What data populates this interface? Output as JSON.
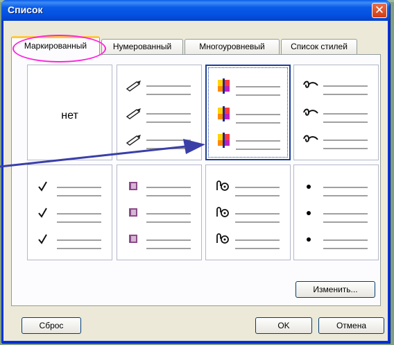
{
  "dialog": {
    "title": "Список",
    "close_glyph": "✕"
  },
  "tabs": [
    {
      "label": "Маркированный",
      "active": true
    },
    {
      "label": "Нумерованный",
      "active": false
    },
    {
      "label": "Многоуровневый",
      "active": false
    },
    {
      "label": "Список стилей",
      "active": false
    }
  ],
  "gallery": {
    "none_label": "нет",
    "cells": [
      {
        "bullet": "none"
      },
      {
        "bullet": "pen-nib-icon"
      },
      {
        "bullet": "color-marker-icon",
        "selected": true
      },
      {
        "bullet": "flourish-icon"
      },
      {
        "bullet": "checkmark-icon"
      },
      {
        "bullet": "square-bullet-icon"
      },
      {
        "bullet": "scroll-clip-icon"
      },
      {
        "bullet": "dot-bullet-icon"
      }
    ]
  },
  "buttons": {
    "modify": "Изменить...",
    "reset": "Сброс",
    "ok": "OK",
    "cancel": "Отмена"
  },
  "colors": {
    "title_bar": "#0a5ce8",
    "highlight_ellipse": "#ff22dd",
    "pointer_arrow": "#3a3fa8"
  }
}
